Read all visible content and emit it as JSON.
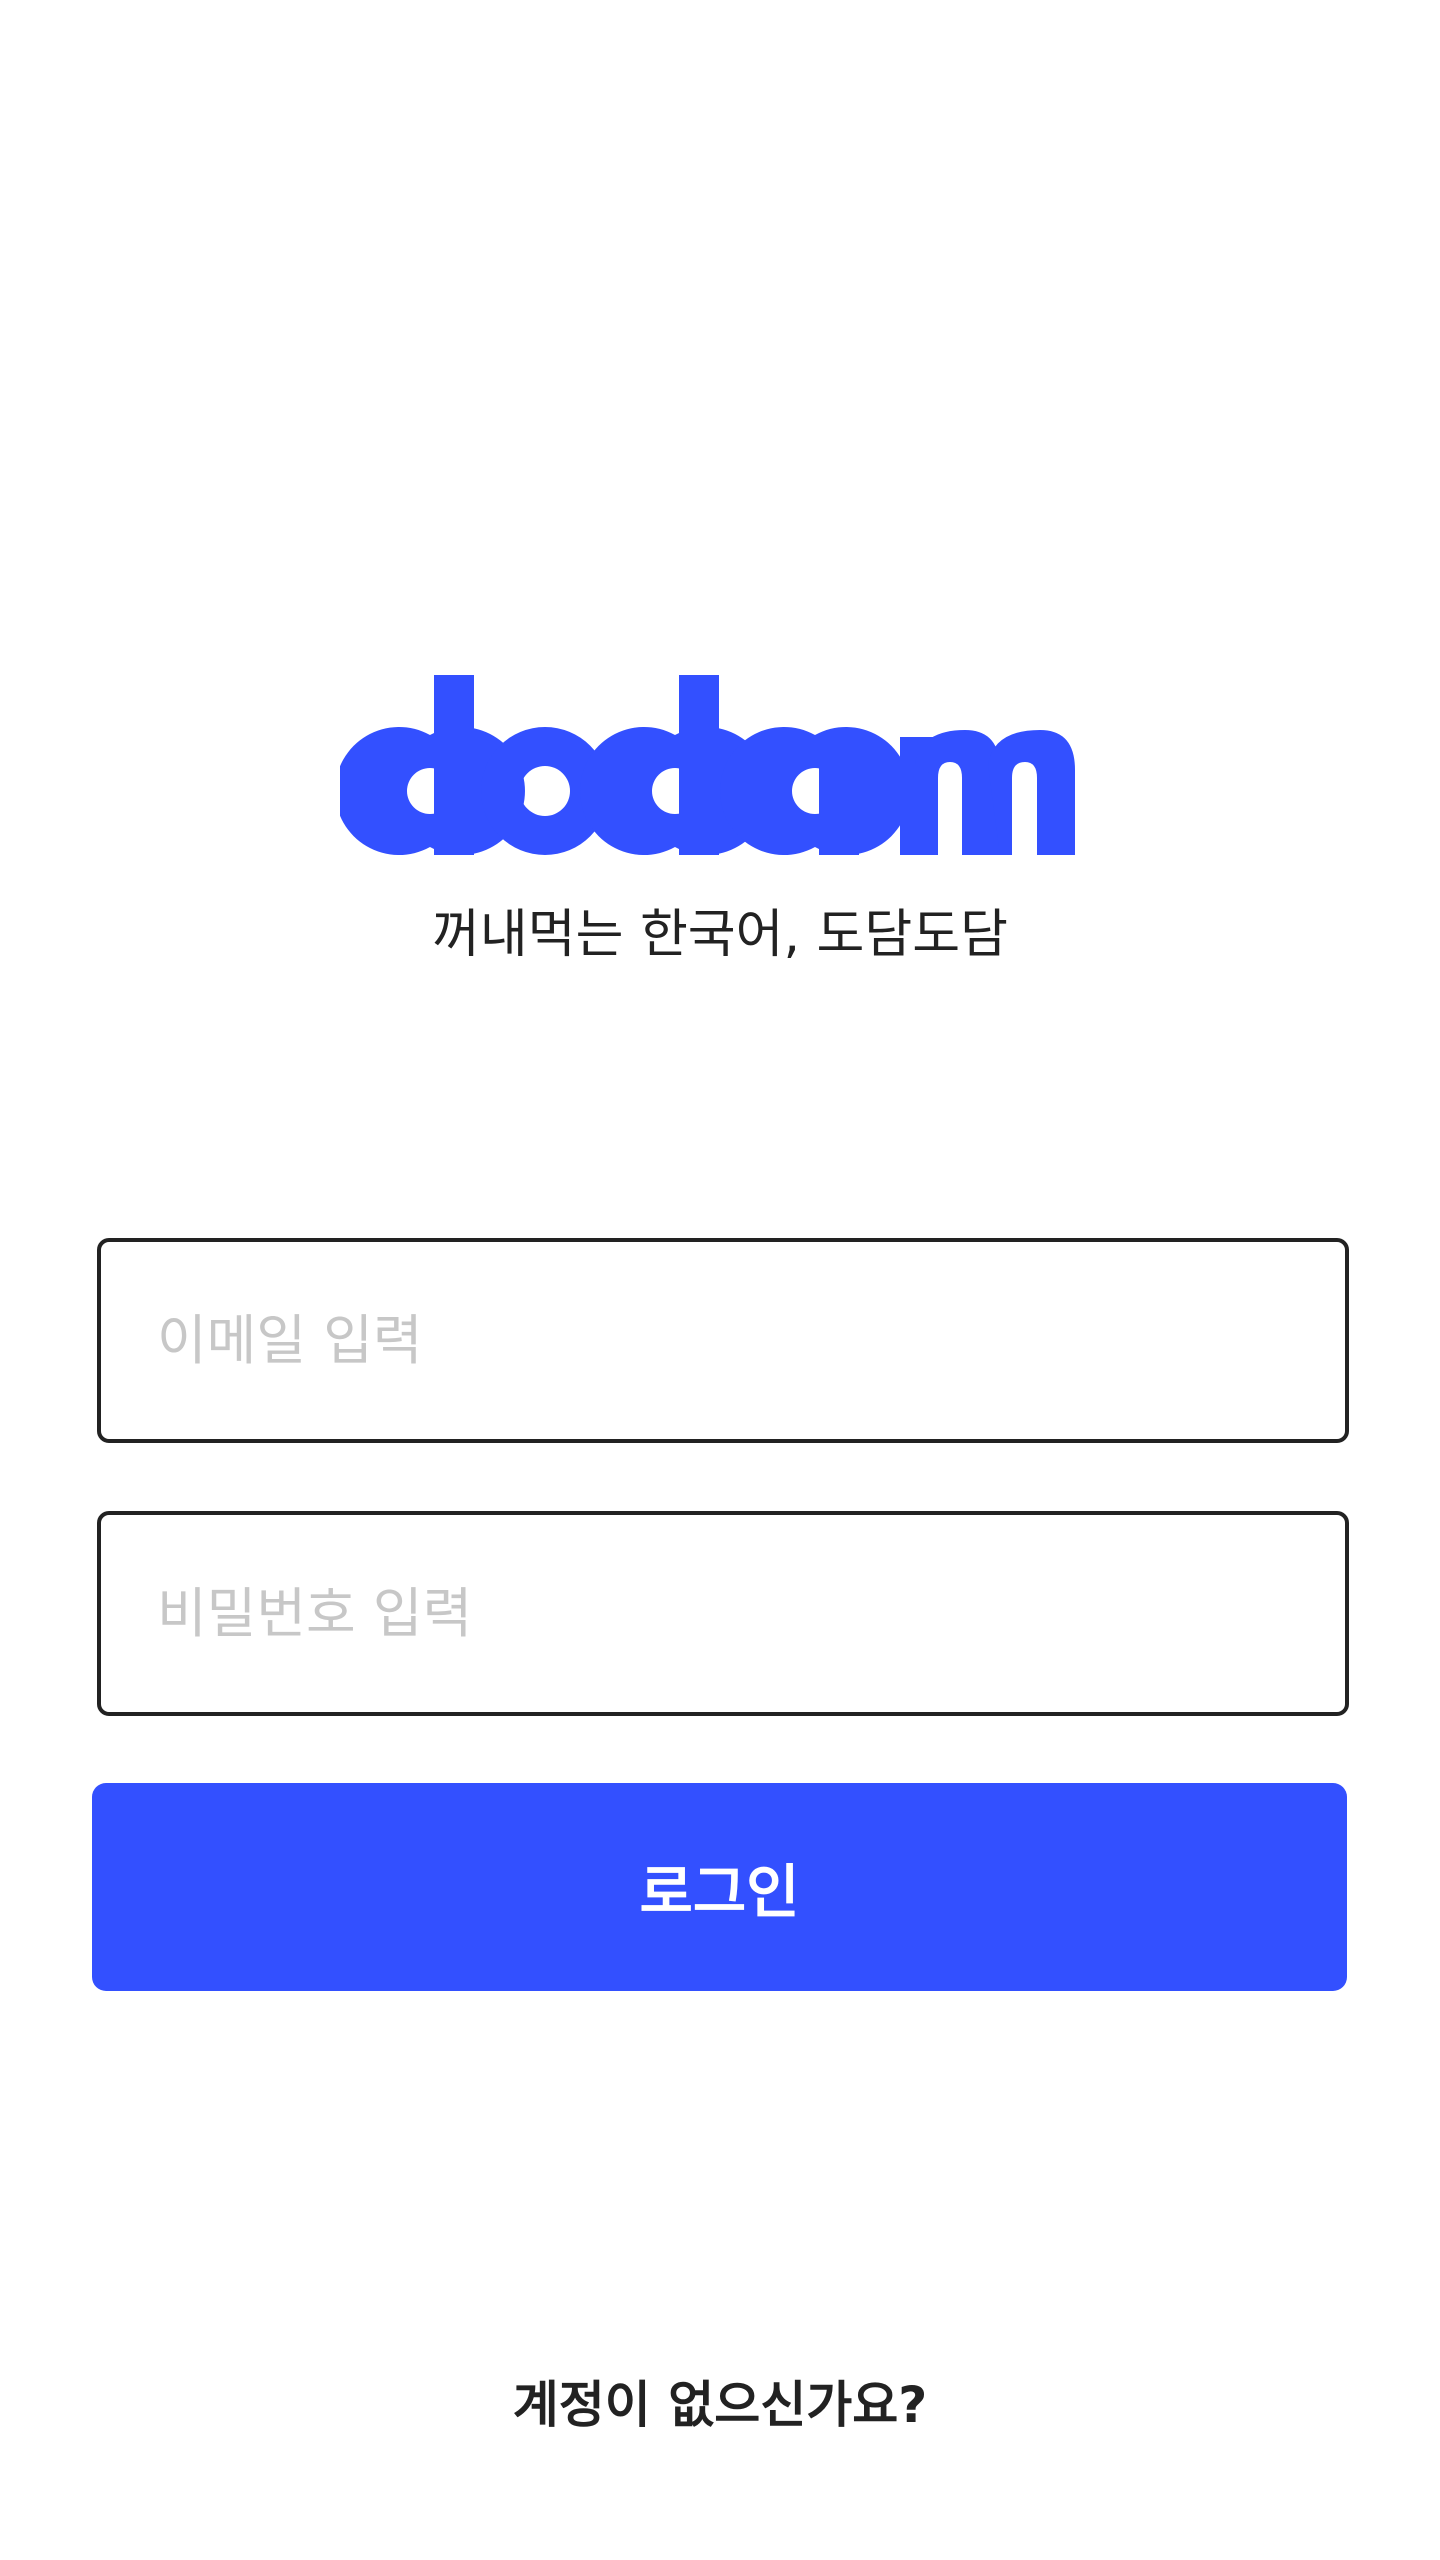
{
  "brand": {
    "logo_text": "dodam",
    "logo_color": "#3350ff",
    "tagline": "꺼내먹는 한국어, 도담도담"
  },
  "login_form": {
    "email_placeholder": "이메일 입력",
    "email_value": "",
    "password_placeholder": "비밀번호 입력",
    "password_value": "",
    "login_label": "로그인"
  },
  "footer": {
    "signup_link": "계정이 없으신가요?"
  },
  "colors": {
    "accent": "#3350ff",
    "border": "#222222",
    "placeholder": "#c7c7c7",
    "text": "#222222",
    "background": "#ffffff"
  }
}
